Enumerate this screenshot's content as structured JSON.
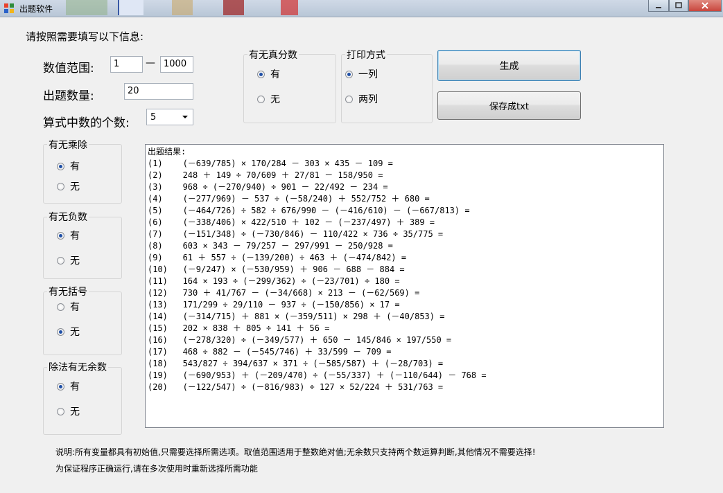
{
  "window": {
    "title": "出题软件"
  },
  "instruction": "请按照需要填写以下信息:",
  "range": {
    "label": "数值范围:",
    "min": "1",
    "dash": "—",
    "max": "1000"
  },
  "count": {
    "label": "出题数量:",
    "value": "20"
  },
  "nums": {
    "label": "算式中数的个数:",
    "value": "5"
  },
  "fraction_group": {
    "title": "有无真分数",
    "opt_yes": "有",
    "opt_no": "无",
    "selected": "有"
  },
  "print_group": {
    "title": "打印方式",
    "opt_one": "一列",
    "opt_two": "两列",
    "selected": "一列"
  },
  "buttons": {
    "generate": "生成",
    "save": "保存成txt"
  },
  "muldiv_group": {
    "title": "有无乘除",
    "opt_yes": "有",
    "opt_no": "无",
    "selected": "有"
  },
  "negative_group": {
    "title": "有无负数",
    "opt_yes": "有",
    "opt_no": "无",
    "selected": "有"
  },
  "bracket_group": {
    "title": "有无括号",
    "opt_yes": "有",
    "opt_no": "无",
    "selected": "无"
  },
  "remainder_group": {
    "title": "除法有无余数",
    "opt_yes": "有",
    "opt_no": "无",
    "selected": "有"
  },
  "results": {
    "header": "出题结果:",
    "lines": [
      "(1)    (－639/785) × 170/284 － 303 × 435 － 109 =",
      "(2)    248 ＋ 149 ÷ 70/609 ＋ 27/81 － 158/950 =",
      "(3)    968 ÷ (－270/940) ÷ 901 － 22/492 － 234 =",
      "(4)    (－277/969) － 537 ÷ (－58/240) ＋ 552/752 ＋ 680 =",
      "(5)    (－464/726) ÷ 582 ÷ 676/990 － (－416/610) － (－667/813) =",
      "(6)    (－338/406) × 422/510 ＋ 102 － (－237/497) ＋ 389 =",
      "(7)    (－151/348) ÷ (－730/846) － 110/422 × 736 ÷ 35/775 =",
      "(8)    603 × 343 － 79/257 － 297/991 － 250/928 =",
      "(9)    61 ＋ 557 ÷ (－139/200) ÷ 463 ＋ (－474/842) =",
      "(10)   (－9/247) × (－530/959) ＋ 906 － 688 － 884 =",
      "(11)   164 × 193 ÷ (－299/362) ÷ (－23/701) ÷ 180 =",
      "(12)   730 ＋ 41/767 － (－34/668) × 213 － (－62/569) =",
      "(13)   171/299 ÷ 29/110 － 937 ÷ (－150/856) × 17 =",
      "(14)   (－314/715) ＋ 881 × (－359/511) × 298 ＋ (－40/853) =",
      "(15)   202 × 838 ＋ 805 ÷ 141 ＋ 56 =",
      "(16)   (－278/320) ÷ (－349/577) ＋ 650 － 145/846 × 197/550 =",
      "(17)   468 ÷ 882 － (－545/746) ＋ 33/599 － 709 =",
      "(18)   543/827 ÷ 394/637 × 371 ÷ (－585/587) ＋ (－28/703) =",
      "(19)   (－690/953) ＋ (－209/470) ÷ (－55/337) ＋ (－110/644) － 768 =",
      "(20)   (－122/547) ÷ (－816/983) ÷ 127 × 52/224 ＋ 531/763 ="
    ]
  },
  "notes": {
    "line1": "说明:所有变量都具有初始值,只需要选择所需选项。取值范围适用于整数绝对值;无余数只支持两个数运算判断,其他情况不需要选择!",
    "line2": "为保证程序正确运行,请在多次使用时重新选择所需功能"
  },
  "colors": {
    "radio_dot": "#1e4fa6",
    "close_button": "#c9463d",
    "focus_border": "#3c7fb1"
  }
}
